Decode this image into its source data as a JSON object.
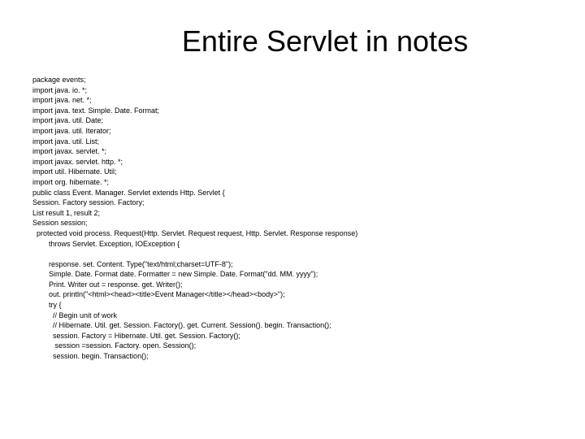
{
  "title": "Entire Servlet in notes",
  "code": "package events;\nimport java. io. *;\nimport java. net. *;\nimport java. text. Simple. Date. Format;\nimport java. util. Date;\nimport java. util. Iterator;\nimport java. util. List;\nimport javax. servlet. *;\nimport javax. servlet. http. *;\nimport util. Hibernate. Util;\nimport org. hibernate. *;\npublic class Event. Manager. Servlet extends Http. Servlet {\nSession. Factory session. Factory;\nList result 1, result 2;\nSession session;\n  protected void process. Request(Http. Servlet. Request request, Http. Servlet. Response response)\n        throws Servlet. Exception, IOException {\n\n        response. set. Content. Type(\"text/html;charset=UTF-8\");\n        Simple. Date. Format date. Formatter = new Simple. Date. Format(\"dd. MM. yyyy\");\n        Print. Writer out = response. get. Writer();\n        out. println(\"<html><head><title>Event Manager</title></head><body>\");\n        try {\n          // Begin unit of work\n          // Hibernate. Util. get. Session. Factory(). get. Current. Session(). begin. Transaction();\n          session. Factory = Hibernate. Util. get. Session. Factory();\n           session =session. Factory. open. Session();\n          session. begin. Transaction();"
}
